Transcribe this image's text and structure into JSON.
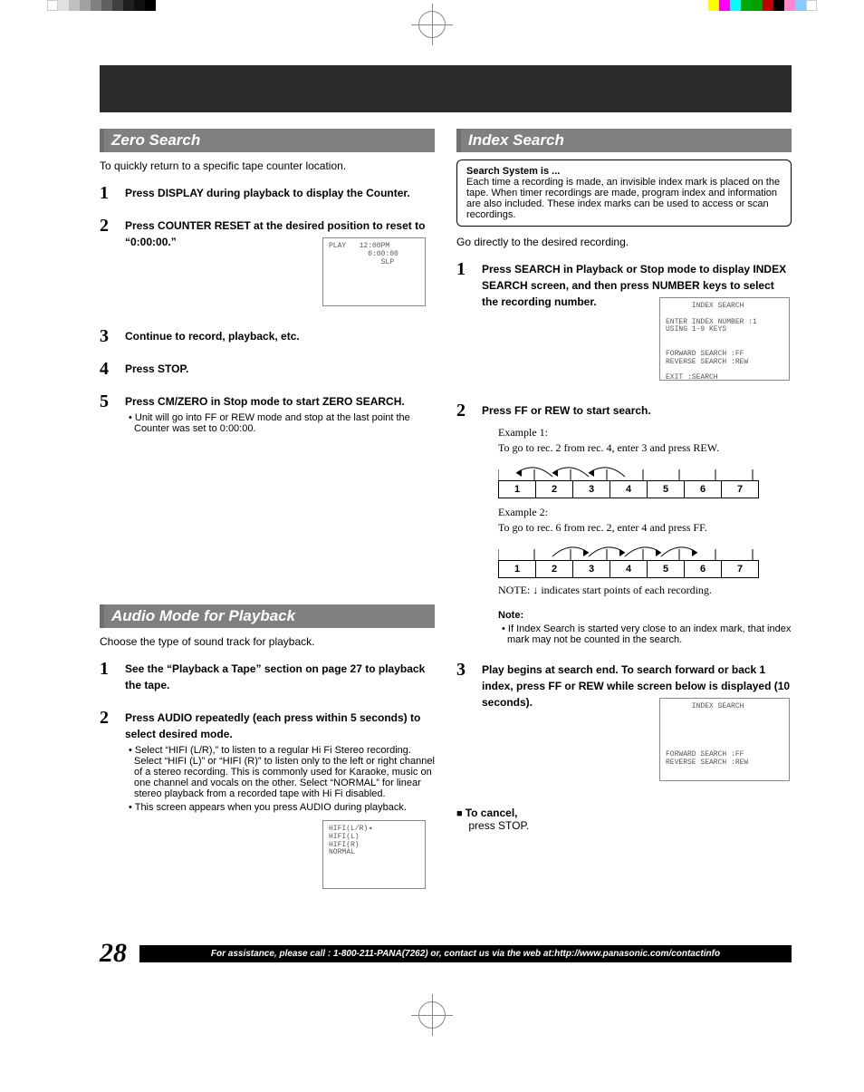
{
  "page_number": "28",
  "assist_bar": "For assistance, please call : 1-800-211-PANA(7262) or, contact us via the web at:http://www.panasonic.com/contactinfo",
  "zero": {
    "title": "Zero Search",
    "intro": "To quickly return to a specific tape counter location.",
    "steps": [
      {
        "n": "1",
        "text": "Press DISPLAY during playback to display the Counter."
      },
      {
        "n": "2",
        "text": "Press COUNTER RESET at the desired position to reset to “0:00:00.”",
        "osd": "PLAY   12:00PM\n         0:00:00\n            SLP"
      },
      {
        "n": "3",
        "text": "Continue to record, playback, etc."
      },
      {
        "n": "4",
        "text": "Press STOP."
      },
      {
        "n": "5",
        "text": "Press CM/ZERO in Stop mode to start ZERO SEARCH.",
        "sub": "Unit will go into FF or REW mode and stop at the last point the Counter was set to 0:00:00."
      }
    ]
  },
  "audio": {
    "title": "Audio Mode for Playback",
    "intro": "Choose the type of sound track for playback.",
    "steps": [
      {
        "n": "1",
        "text": "See the “Playback a Tape” section on page 27 to playback the tape."
      },
      {
        "n": "2",
        "text": "Press AUDIO repeatedly (each press within 5 seconds) to select desired mode.",
        "sub1": "Select “HIFI (L/R),” to listen to a regular Hi Fi Stereo recording. Select “HIFI (L)” or “HIFI (R)” to listen only to the left or right channel of a stereo recording. This is commonly used for Karaoke, music on one channel and vocals on the other. Select “NORMAL” for linear stereo playback from a recorded tape with Hi Fi disabled.",
        "sub2": "This screen appears when you press AUDIO during playback.",
        "osd": "HIFI(L/R)◂\nHIFI(L)\nHIFI(R)\nNORMAL"
      }
    ]
  },
  "index": {
    "title": "Index Search",
    "box_title": "Search System is ...",
    "box_body": "Each time a recording is made, an invisible index mark is placed on the tape. When timer recordings are made, program index and information are also included. These index marks can be used to access or scan recordings.",
    "intro": "Go directly to the desired recording.",
    "step1": {
      "n": "1",
      "text": "Press SEARCH in Playback or Stop mode to display INDEX SEARCH screen, and then press NUMBER keys to select the recording number.",
      "osd": "      INDEX SEARCH\n\nENTER INDEX NUMBER :1\nUSING 1-9 KEYS\n\n\nFORWARD SEARCH :FF\nREVERSE SEARCH :REW\n\nEXIT :SEARCH"
    },
    "step2": {
      "n": "2",
      "text": "Press FF or REW to start search.",
      "ex1_label": "Example 1:",
      "ex1_instr": "To go to rec. 2 from rec. 4, enter 3 and press REW.",
      "ex2_label": "Example 2:",
      "ex2_instr": "To go to rec. 6 from rec. 2, enter 4 and press FF.",
      "cells": [
        "1",
        "2",
        "3",
        "4",
        "5",
        "6",
        "7"
      ],
      "footnote": "NOTE: ↓ indicates start points of each recording.",
      "note_title": "Note:",
      "note_body": "If Index Search is started very close to an index mark, that index mark may not be counted in the search."
    },
    "step3": {
      "n": "3",
      "text": "Play begins at search end. To search forward or back 1 index, press FF or REW while screen below is displayed (10 seconds).",
      "osd": "      INDEX SEARCH\n\n\n\n\n\nFORWARD SEARCH :FF\nREVERSE SEARCH :REW"
    },
    "cancel_title": "To cancel,",
    "cancel_body": "press STOP."
  }
}
